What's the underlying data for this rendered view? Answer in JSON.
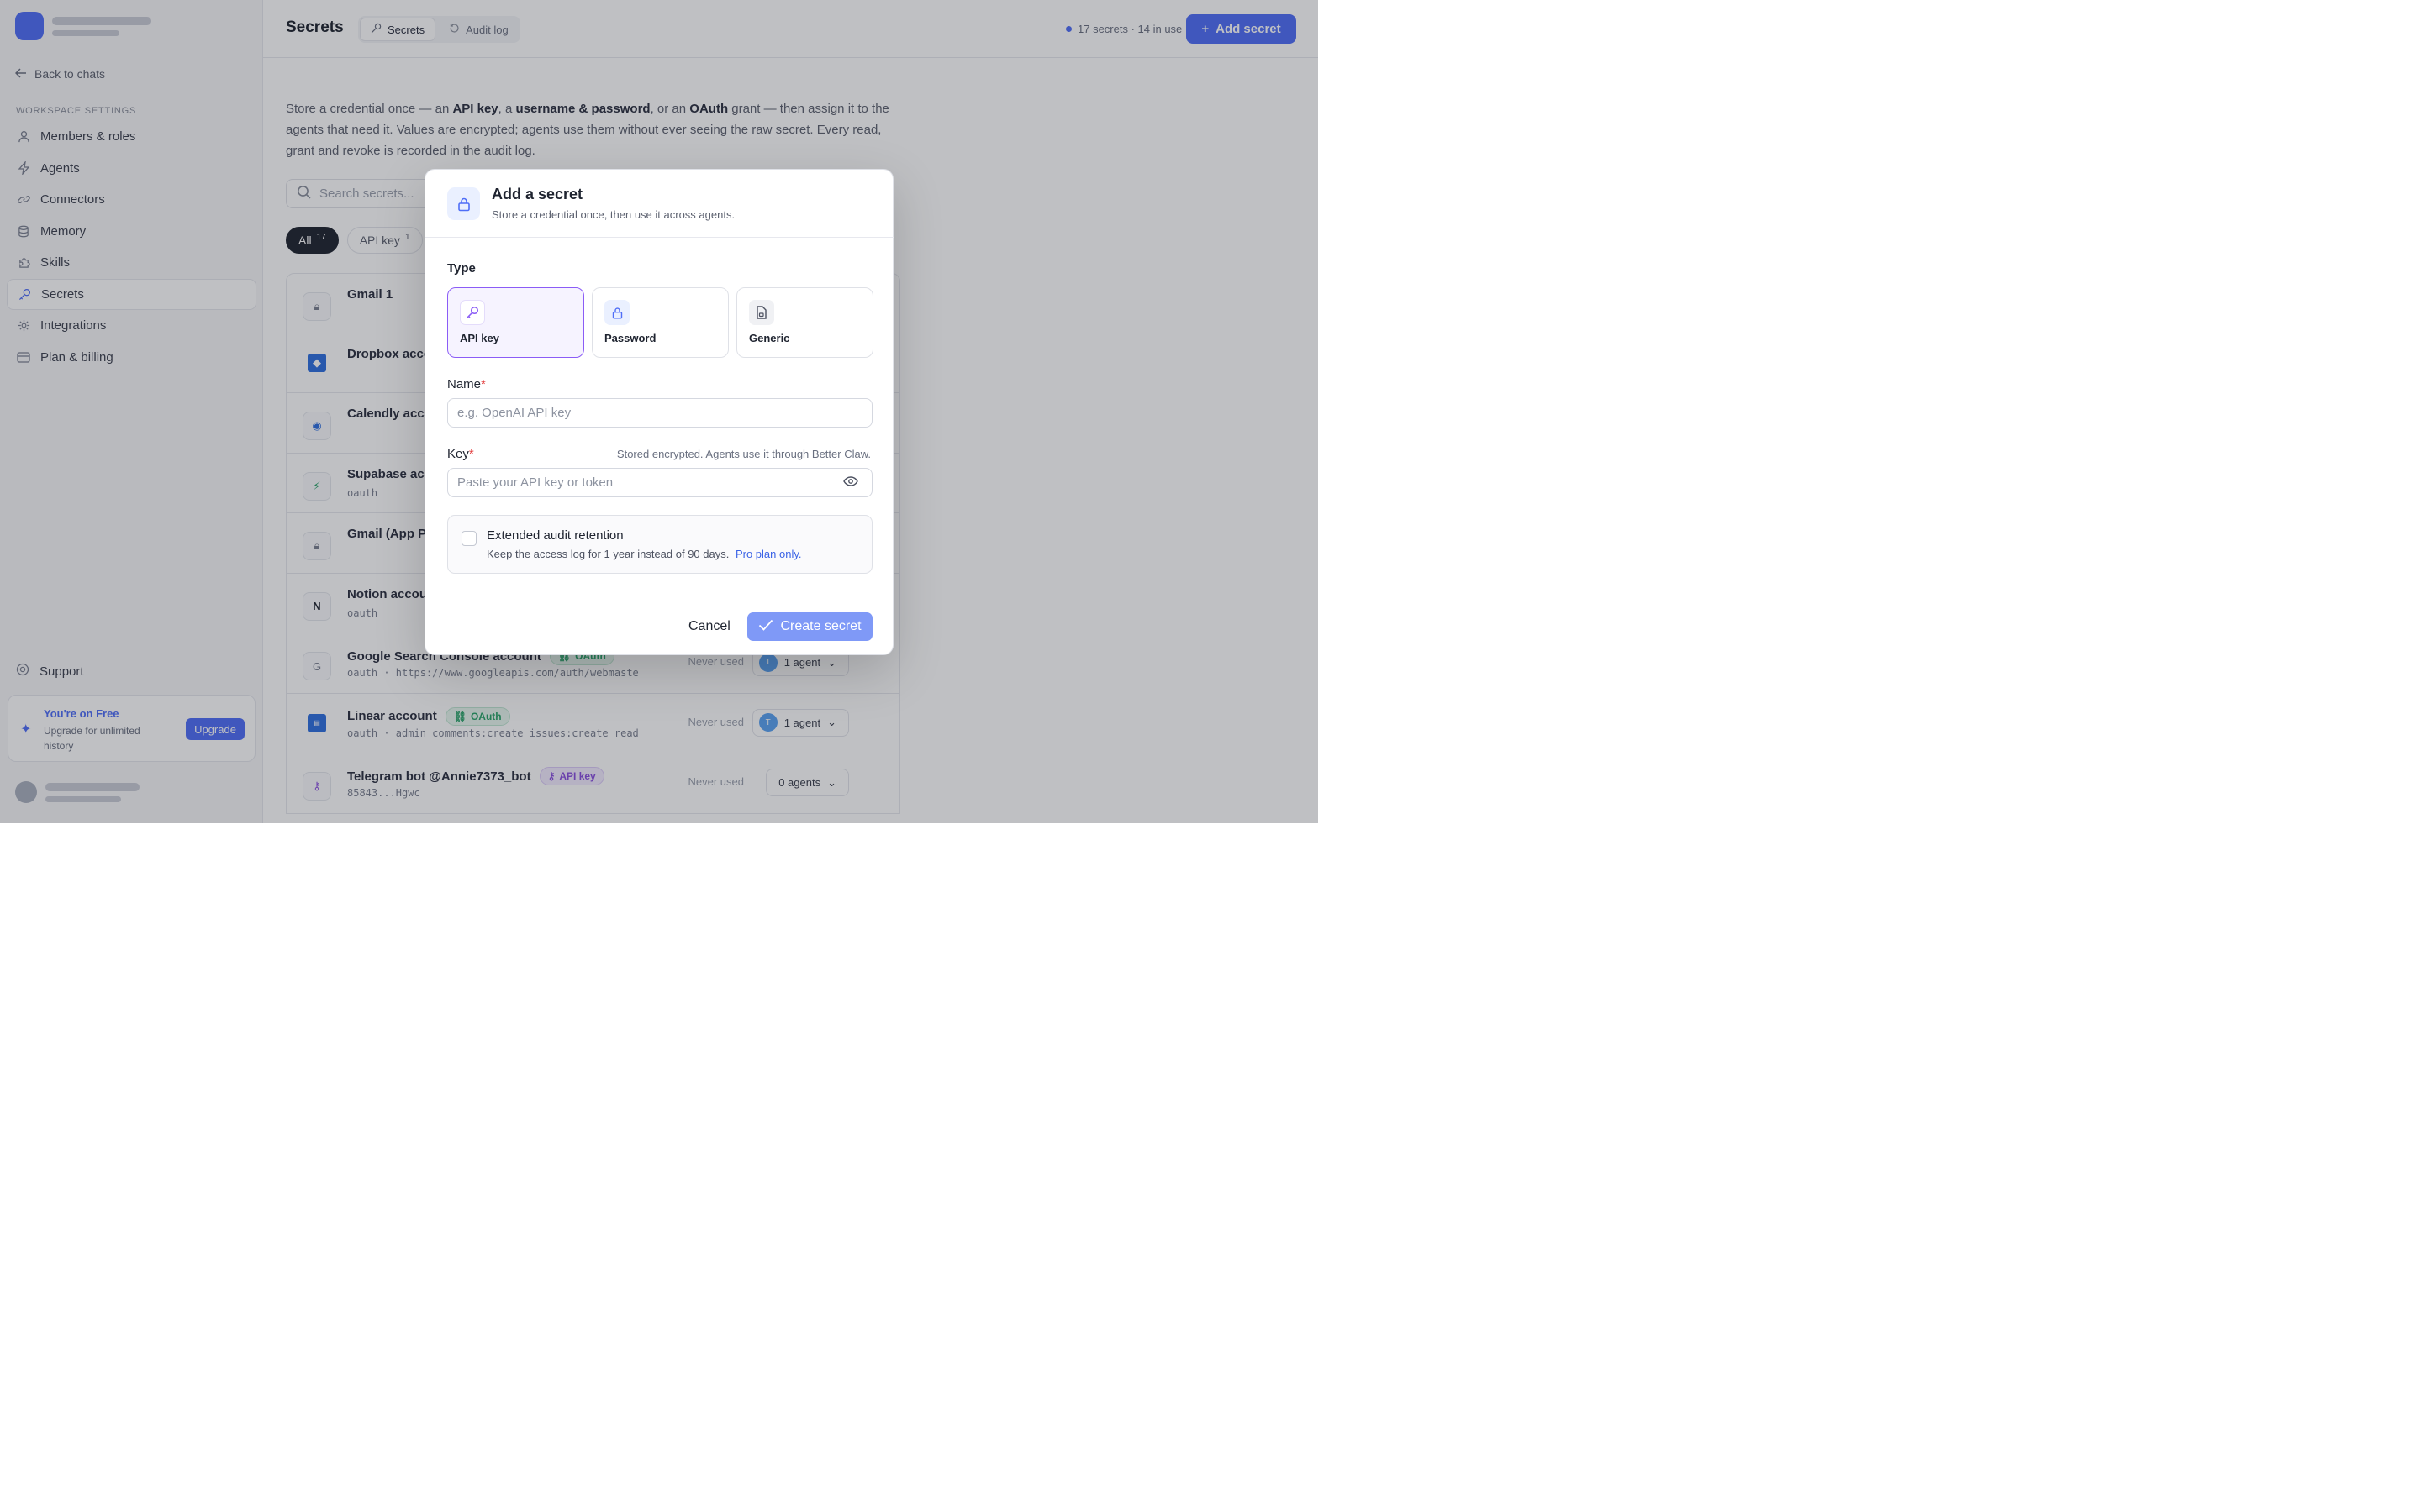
{
  "sidebar": {
    "back_label": "Back to chats",
    "section_label": "WORKSPACE SETTINGS",
    "items": [
      {
        "label": "Members & roles",
        "icon": "user-icon"
      },
      {
        "label": "Agents",
        "icon": "bolt-icon"
      },
      {
        "label": "Connectors",
        "icon": "link-icon"
      },
      {
        "label": "Memory",
        "icon": "database-icon"
      },
      {
        "label": "Skills",
        "icon": "puzzle-icon"
      },
      {
        "label": "Secrets",
        "icon": "key-icon",
        "active": true
      },
      {
        "label": "Integrations",
        "icon": "integrations-icon"
      },
      {
        "label": "Plan & billing",
        "icon": "card-icon"
      }
    ],
    "support_label": "Support",
    "upgrade": {
      "title": "You're on Free",
      "subtitle": "Upgrade for unlimited history",
      "button": "Upgrade"
    }
  },
  "header": {
    "title": "Secrets",
    "tabs": [
      {
        "label": "Secrets",
        "active": true
      },
      {
        "label": "Audit log",
        "active": false
      }
    ],
    "stats": "17 secrets · 14 in use",
    "add_button": "Add secret"
  },
  "intro": {
    "p1": "Store a credential once — an ",
    "b1": "API key",
    "p2": ", a ",
    "b2": "username & password",
    "p3": ", or an ",
    "b3": "OAuth",
    "p4": " grant — then assign it to the agents that need it. Values are encrypted; agents use them without ever seeing the raw secret. Every read, grant and revoke is recorded in the audit log."
  },
  "search": {
    "placeholder": "Search secrets..."
  },
  "filters": [
    {
      "label": "All",
      "count": "17",
      "active": true
    },
    {
      "label": "API key",
      "count": "1",
      "active": false
    }
  ],
  "rows": [
    {
      "name": "Gmail 1",
      "badge": "",
      "sub": "",
      "used": "",
      "agents": ""
    },
    {
      "name": "Dropbox acco",
      "badge": "",
      "sub": "",
      "used": "",
      "agents": ""
    },
    {
      "name": "Calendly acc",
      "badge": "",
      "sub": "",
      "used": "",
      "agents": ""
    },
    {
      "name": "Supabase ac",
      "badge": "",
      "sub": "oauth",
      "used": "",
      "agents": ""
    },
    {
      "name": "Gmail (App P",
      "badge": "",
      "sub": "",
      "used": "",
      "agents": ""
    },
    {
      "name": "Notion accou",
      "badge": "",
      "sub": "oauth",
      "used": "",
      "agents": ""
    },
    {
      "name": "Google Search Console account",
      "badge": "OAuth",
      "sub": "oauth · https://www.googleapis.com/auth/webmaste",
      "used": "Never used",
      "agents": "1 agent",
      "avatar": "T"
    },
    {
      "name": "Linear account",
      "badge": "OAuth",
      "sub": "oauth · admin comments:create issues:create read",
      "used": "Never used",
      "agents": "1 agent",
      "avatar": "T"
    },
    {
      "name": "Telegram bot @Annie7373_bot",
      "badge": "API key",
      "sub": "85843...Hgwc",
      "used": "Never used",
      "agents": "0 agents"
    }
  ],
  "modal": {
    "title": "Add a secret",
    "subtitle": "Store a credential once, then use it across agents.",
    "type_label": "Type",
    "types": [
      {
        "label": "API key",
        "icon": "key-icon",
        "selected": true
      },
      {
        "label": "Password",
        "icon": "lock-icon",
        "selected": false
      },
      {
        "label": "Generic",
        "icon": "file-icon",
        "selected": false
      }
    ],
    "name_label": "Name",
    "name_placeholder": "e.g. OpenAI API key",
    "key_label": "Key",
    "key_hint": "Stored encrypted. Agents use it through Better Claw.",
    "key_placeholder": "Paste your API key or token",
    "required_mark": "*",
    "retention": {
      "title": "Extended audit retention",
      "subtitle": "Keep the access log for 1 year instead of 90 days.",
      "pro": "Pro plan only."
    },
    "cancel": "Cancel",
    "create": "Create secret"
  },
  "colors": {
    "accent": "#4f6ef7",
    "selected_border": "#8b5cf6",
    "oauth_badge": "#2aa46a",
    "api_badge": "#8a4fe0"
  }
}
